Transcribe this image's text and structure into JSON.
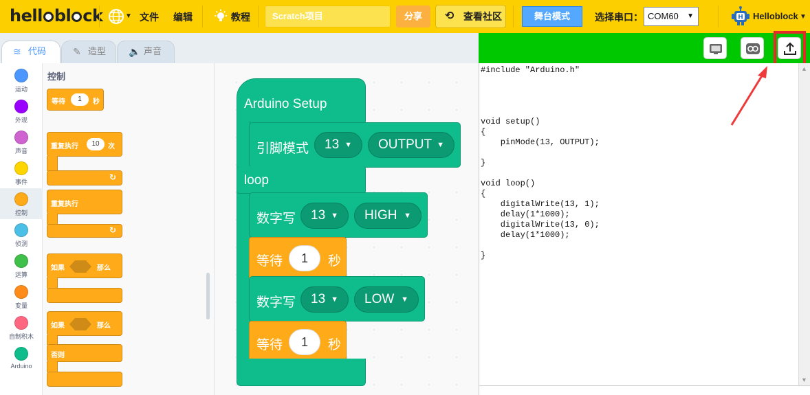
{
  "menubar": {
    "logo": "helloblock",
    "items": [
      {
        "label": "文件"
      },
      {
        "label": "编辑"
      },
      {
        "label": "教程"
      }
    ],
    "project_name": "Scratch项目",
    "share": "分享",
    "community": "查看社区",
    "stage_mode": "舞台模式",
    "port_label": "选择串口：",
    "port_value": "COM60",
    "user": "Helloblock"
  },
  "tabs": [
    {
      "label": "代码",
      "icon": "code-icon"
    },
    {
      "label": "造型",
      "icon": "brush-icon"
    },
    {
      "label": "声音",
      "icon": "speaker-icon"
    }
  ],
  "categories": [
    {
      "label": "运动",
      "color": "#4c97ff"
    },
    {
      "label": "外观",
      "color": "#9900ff"
    },
    {
      "label": "声音",
      "color": "#cf63cf"
    },
    {
      "label": "事件",
      "color": "#ffd500"
    },
    {
      "label": "控制",
      "color": "#ffab19"
    },
    {
      "label": "侦测",
      "color": "#4cbfe6"
    },
    {
      "label": "运算",
      "color": "#40bf4a"
    },
    {
      "label": "变量",
      "color": "#ff8c1a"
    },
    {
      "label": "自制积木",
      "color": "#ff6680"
    },
    {
      "label": "Arduino",
      "color": "#0fbd8c"
    }
  ],
  "palette": {
    "title": "控制",
    "wait": {
      "label": "等待",
      "value": "1",
      "unit": "秒"
    },
    "repeat": {
      "label": "重复执行",
      "value": "10",
      "unit": "次"
    },
    "forever": {
      "label": "重复执行"
    },
    "if_then": {
      "if": "如果",
      "then": "那么"
    },
    "if_else": {
      "if": "如果",
      "then": "那么",
      "else": "否则"
    }
  },
  "script": {
    "setup_hat": "Arduino Setup",
    "pin_mode": {
      "label": "引脚模式",
      "pin": "13",
      "mode": "OUTPUT"
    },
    "loop_label": "loop",
    "digital_write_1": {
      "label": "数字写",
      "pin": "13",
      "level": "HIGH"
    },
    "wait_1": {
      "label": "等待",
      "value": "1",
      "unit": "秒"
    },
    "digital_write_2": {
      "label": "数字写",
      "pin": "13",
      "level": "LOW"
    },
    "wait_2": {
      "label": "等待",
      "value": "1",
      "unit": "秒"
    }
  },
  "code": {
    "lines": [
      "#include \"Arduino.h\"",
      "",
      "",
      "",
      "",
      "void setup()",
      "{",
      "    pinMode(13, OUTPUT);",
      "",
      "}",
      "",
      "void loop()",
      "{",
      "    digitalWrite(13, 1);",
      "    delay(1*1000);",
      "    digitalWrite(13, 0);",
      "    delay(1*1000);",
      "",
      "}"
    ],
    "toolbar": [
      "serial-monitor-icon",
      "arduino-icon",
      "upload-icon"
    ]
  },
  "colors": {
    "menubar": "#fccf01",
    "control": "#ffab19",
    "arduino": "#0fbd8c",
    "code_header": "#00c800",
    "highlight": "#e52a2a"
  }
}
